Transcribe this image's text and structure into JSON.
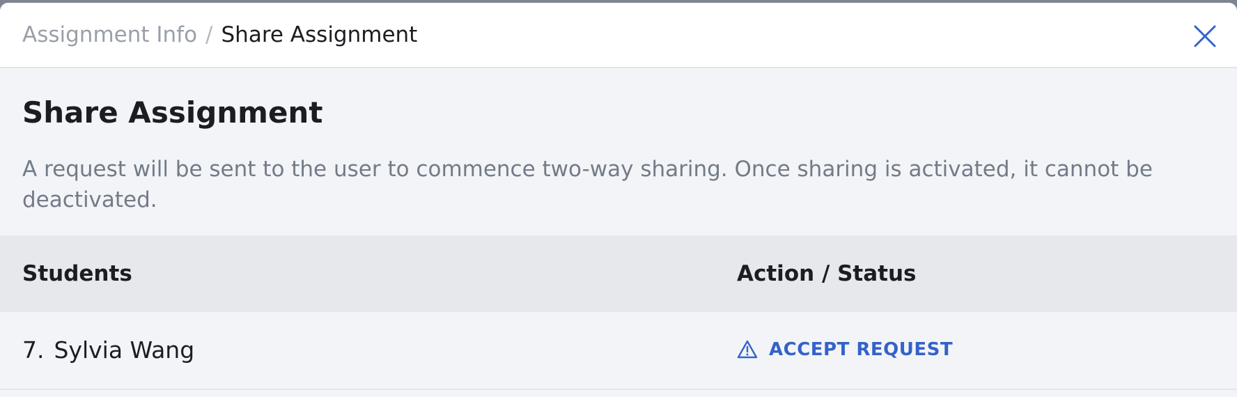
{
  "breadcrumb": {
    "parent": "Assignment Info",
    "separator": "/",
    "current": "Share Assignment"
  },
  "close_icon": "close-icon",
  "page_title": "Share Assignment",
  "description": "A request will be sent to the user to commence two-way sharing. Once sharing is activated, it cannot be deactivated.",
  "table": {
    "headers": {
      "students": "Students",
      "action_status": "Action / Status"
    },
    "rows": [
      {
        "index": "7.",
        "name": "Sylvia Wang",
        "action_icon": "warning-icon",
        "action_label": "ACCEPT REQUEST"
      }
    ]
  },
  "colors": {
    "accent": "#3462c9",
    "muted_text": "#737b88",
    "header_bg": "#e7e8ec",
    "body_bg": "#f3f4f7"
  }
}
